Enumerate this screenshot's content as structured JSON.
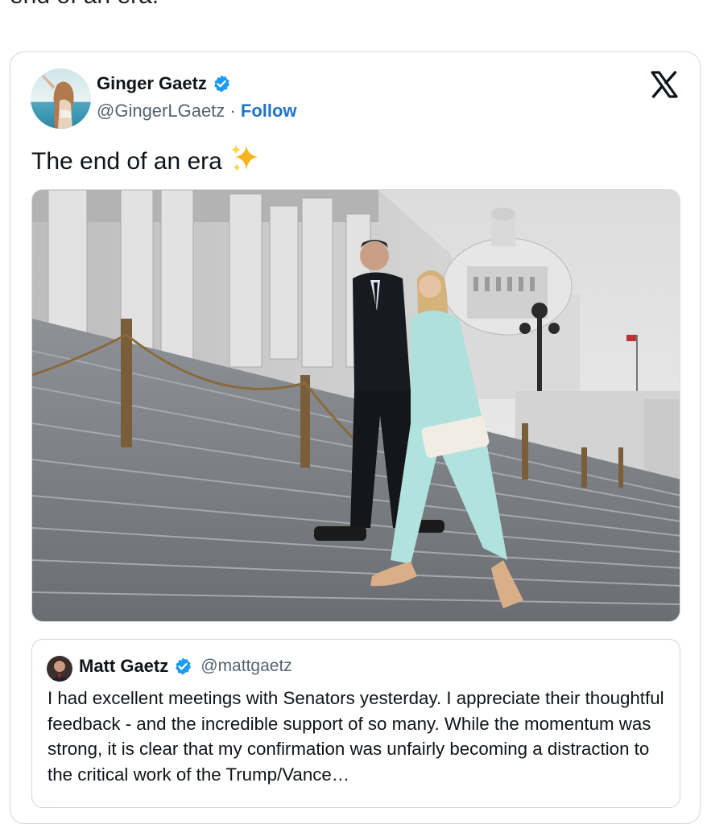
{
  "context_text": "end of an era.",
  "tweet": {
    "author_name": "Ginger Gaetz",
    "author_handle": "@GingerLGaetz",
    "separator": "·",
    "follow_label": "Follow",
    "text": "The end of an era",
    "emoji": "✨"
  },
  "quoted_tweet": {
    "author_name": "Matt Gaetz",
    "author_handle": "@mattgaetz",
    "text": "I had excellent meetings with Senators yesterday.  I appreciate their thoughtful feedback - and the incredible support of so many.  While the momentum was strong, it is clear that my confirmation was unfairly becoming a distraction to the critical work of the Trump/Vance…"
  },
  "colors": {
    "verified_badge": "#1d9bf0",
    "follow_link": "#1d74c9",
    "handle_gray": "#536471",
    "border": "#cfd9de",
    "text": "#0f1419"
  },
  "icons": {
    "brand": "x-logo-icon",
    "verified": "verified-badge-icon",
    "sparkles": "sparkles-emoji"
  }
}
